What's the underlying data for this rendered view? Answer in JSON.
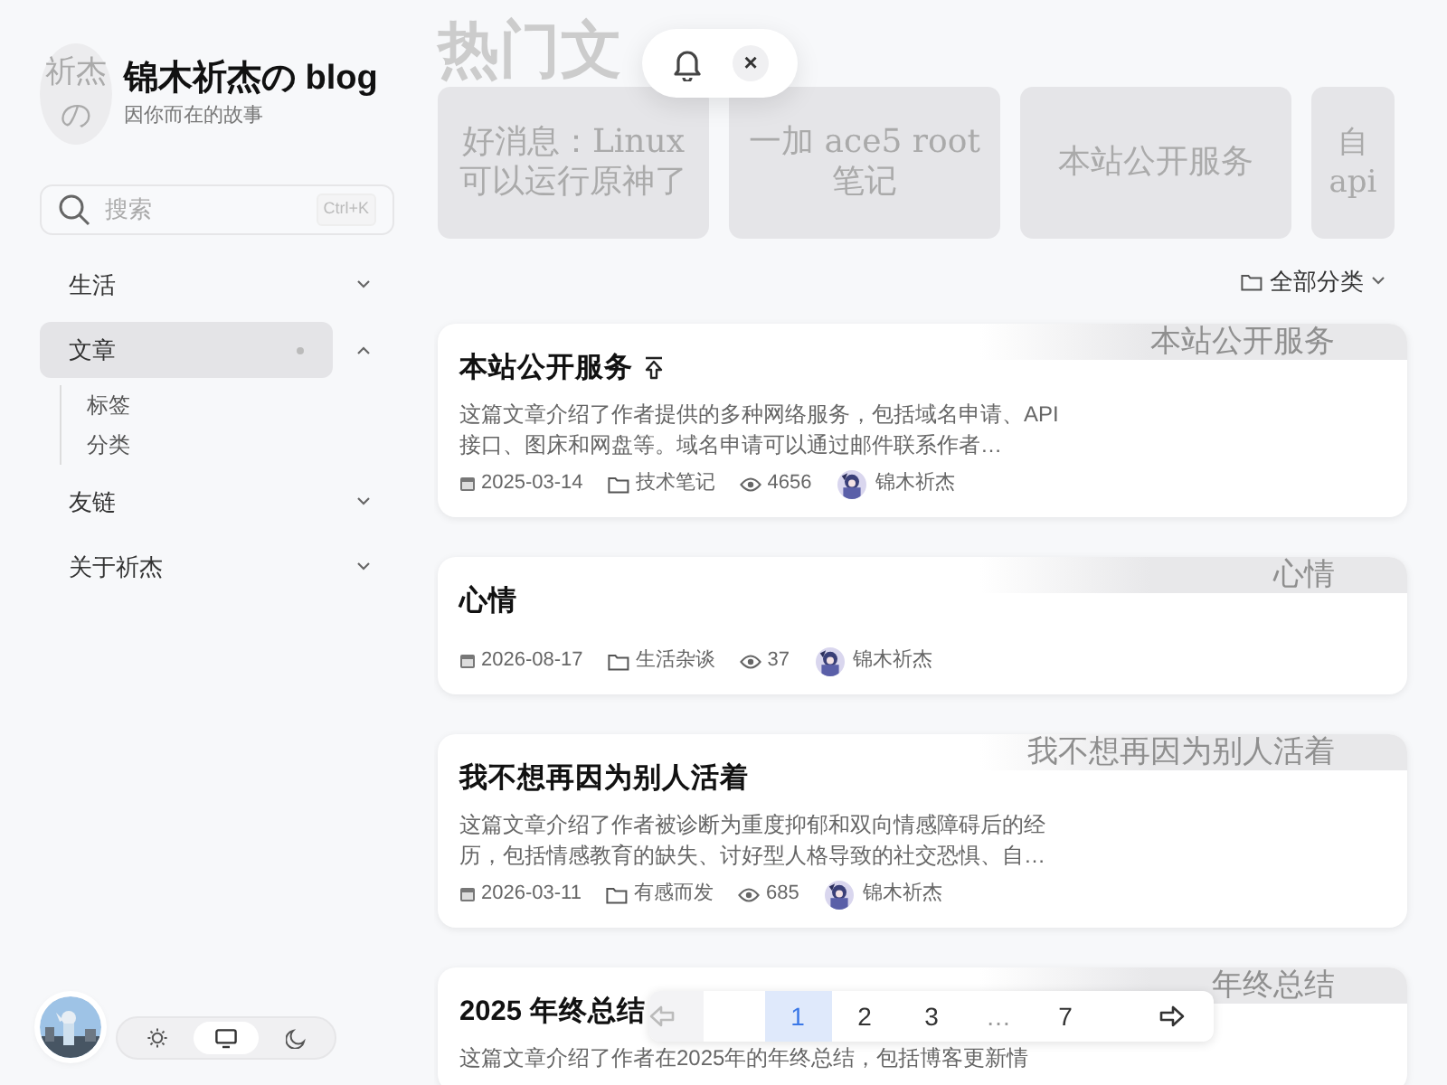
{
  "site": {
    "logo_text": "祈杰の",
    "title": "锦木祈杰の blog",
    "subtitle": "因你而在的故事"
  },
  "search": {
    "placeholder": "搜索",
    "shortcut": "Ctrl+K"
  },
  "nav": [
    {
      "label": "生活",
      "selected": false,
      "expanded": false,
      "dot": false
    },
    {
      "label": "文章",
      "selected": true,
      "expanded": true,
      "dot": true,
      "children": [
        {
          "label": "标签"
        },
        {
          "label": "分类"
        }
      ]
    },
    {
      "label": "友链",
      "selected": false,
      "expanded": false,
      "dot": false
    },
    {
      "label": "关于祈杰",
      "selected": false,
      "expanded": false,
      "dot": false
    }
  ],
  "theme_options": [
    {
      "kind": "light",
      "selected": false
    },
    {
      "kind": "system",
      "selected": true
    },
    {
      "kind": "dark",
      "selected": false
    }
  ],
  "hot": {
    "heading": "热门文",
    "cards": [
      {
        "title": "好消息：Linux 可以运行原神了"
      },
      {
        "title": "一加 ace5 root 笔记"
      },
      {
        "title": "本站公开服务"
      },
      {
        "title": "自 api"
      }
    ]
  },
  "notification": {
    "close": "×"
  },
  "filter": {
    "label": "全部分类"
  },
  "posts": [
    {
      "title": "本站公开服务",
      "pinned": true,
      "banner": "本站公开服务",
      "excerpt": "这篇文章介绍了作者提供的多种网络服务，包括域名申请、API接口、图床和网盘等。域名申请可以通过邮件联系作者…",
      "date": "2025-03-14",
      "category": "技术笔记",
      "views": "4656",
      "author": "锦木祈杰"
    },
    {
      "title": "心情",
      "pinned": false,
      "banner": "心情",
      "date": "2026-08-17",
      "category": "生活杂谈",
      "views": "37",
      "author": "锦木祈杰"
    },
    {
      "title": "我不想再因为别人活着",
      "pinned": false,
      "banner": "我不想再因为别人活着",
      "excerpt": "这篇文章介绍了作者被诊断为重度抑郁和双向情感障碍后的经历，包括情感教育的缺失、讨好型人格导致的社交恐惧、自…",
      "date": "2026-03-11",
      "category": "有感而发",
      "views": "685",
      "author": "锦木祈杰"
    },
    {
      "title": "2025 年终总结",
      "pinned": false,
      "banner": "年终总结",
      "excerpt": "这篇文章介绍了作者在2025年的年终总结，包括博客更新情"
    }
  ],
  "pagination": {
    "prev_disabled": true,
    "next_disabled": false,
    "pages": [
      {
        "label": "1",
        "selected": true
      },
      {
        "label": "2",
        "selected": false
      },
      {
        "label": "3",
        "selected": false
      },
      {
        "label": "…",
        "selected": false
      },
      {
        "label": "7",
        "selected": false
      }
    ]
  }
}
